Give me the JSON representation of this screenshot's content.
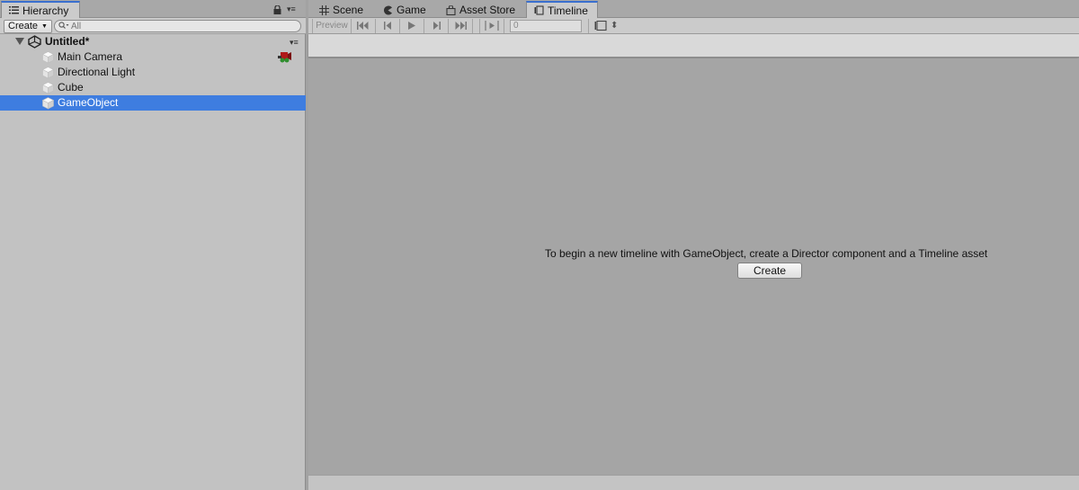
{
  "hierarchy": {
    "tab_label": "Hierarchy",
    "menu_glyph": "▾≡",
    "create_label": "Create",
    "search_placeholder": "All",
    "scene": {
      "name": "Untitled*",
      "menu_glyph": "▾≡"
    },
    "objects": [
      {
        "label": "Main Camera",
        "selected": false
      },
      {
        "label": "Directional Light",
        "selected": false
      },
      {
        "label": "Cube",
        "selected": false
      },
      {
        "label": "GameObject",
        "selected": true
      }
    ]
  },
  "tabs": {
    "scene": "Scene",
    "game": "Game",
    "asset_store": "Asset Store",
    "timeline": "Timeline"
  },
  "timeline": {
    "preview_label": "Preview",
    "frame_value": "0",
    "message": "To begin a new timeline with GameObject, create a Director component and a Timeline asset",
    "create_button": "Create"
  },
  "colors": {
    "selection": "#3e7de0",
    "active_tab_accent": "#3a6fce"
  }
}
